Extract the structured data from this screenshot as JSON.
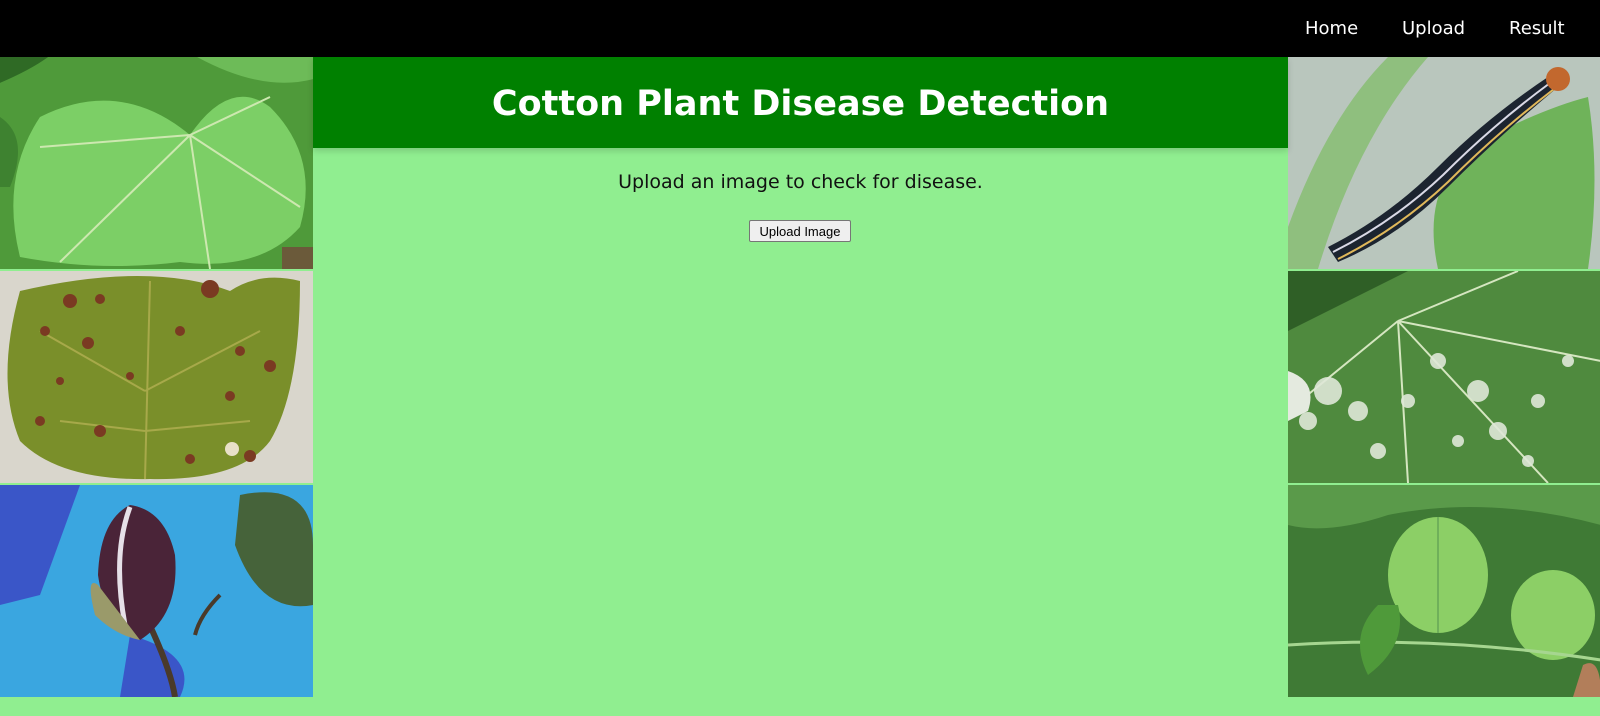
{
  "nav": {
    "home": "Home",
    "upload": "Upload",
    "result": "Result"
  },
  "header": {
    "title": "Cotton Plant Disease Detection"
  },
  "main": {
    "instruction": "Upload an image to check for disease.",
    "upload_button": "Upload Image"
  },
  "colors": {
    "navbar": "#000000",
    "header": "#008000",
    "background": "#90ee90"
  },
  "images": {
    "left": [
      "cotton-leaf-healthy",
      "cotton-leaf-spotted",
      "cotton-boll-diseased"
    ],
    "right": [
      "armyworm-on-leaf",
      "powdery-mildew-leaf",
      "green-cotton-bolls"
    ]
  }
}
